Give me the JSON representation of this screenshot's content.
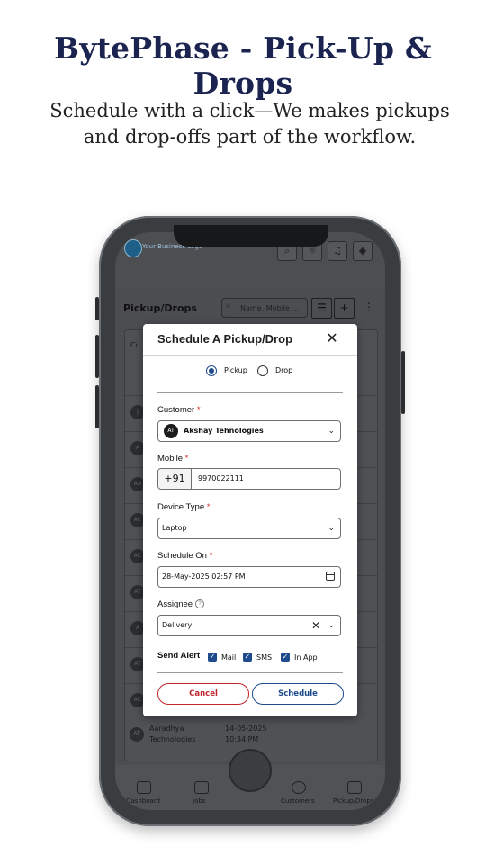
{
  "headline": "BytePhase - Pick-Up & Drops",
  "subtitle": {
    "line1": "Schedule with a click—We makes pickups",
    "line2": "and drop-offs part of the workflow."
  },
  "app": {
    "logo_text": "Your Business Logo",
    "section_title": "Pickup/Drops",
    "search_placeholder": "Name, Mobile ...",
    "table_header_first": "Cu",
    "rows": [
      {
        "initials": "J"
      },
      {
        "initials": "A"
      },
      {
        "initials": "AA"
      },
      {
        "initials": "AC"
      },
      {
        "initials": "AC"
      },
      {
        "initials": "AT"
      },
      {
        "initials": "A"
      },
      {
        "initials": "AT"
      },
      {
        "initials": "AC"
      }
    ],
    "last_row": {
      "initials": "AT",
      "name_line1": "Aaradhya",
      "name_line2": "Technologies",
      "date": "14-05-2025",
      "time": "10:34 PM"
    },
    "tabs": [
      "Dashboard",
      "Jobs",
      "Customers",
      "Pickup/Drops"
    ],
    "top_icons": [
      "search-icon",
      "theme-icon",
      "notification-icon",
      "shield-icon"
    ]
  },
  "modal": {
    "title": "Schedule A Pickup/Drop",
    "close_glyph": "✕",
    "type_options": [
      {
        "label": "Pickup",
        "selected": true
      },
      {
        "label": "Drop",
        "selected": false
      }
    ],
    "customer": {
      "label": "Customer",
      "required_mark": "*",
      "avatar_initials": "AT",
      "value": "Akshay Tehnologies"
    },
    "mobile": {
      "label": "Mobile",
      "required_mark": "*",
      "prefix": "+91",
      "value": "9970022111"
    },
    "device_type": {
      "label": "Device Type",
      "required_mark": "*",
      "value": "Laptop"
    },
    "schedule_on": {
      "label": "Schedule On",
      "required_mark": "*",
      "value": "28-May-2025 02:57 PM"
    },
    "assignee": {
      "label": "Assignee",
      "help_glyph": "?",
      "value": "Delivery"
    },
    "send_alert": {
      "label": "Send Alert",
      "options": [
        {
          "label": "Mail",
          "checked": true
        },
        {
          "label": "SMS",
          "checked": true
        },
        {
          "label": "In App",
          "checked": true
        }
      ]
    },
    "buttons": {
      "cancel": "Cancel",
      "schedule": "Schedule"
    }
  },
  "colors": {
    "headline": "#1b2450",
    "primary": "#1e4b8c",
    "danger": "#c0262d",
    "required": "#d32f2f"
  }
}
